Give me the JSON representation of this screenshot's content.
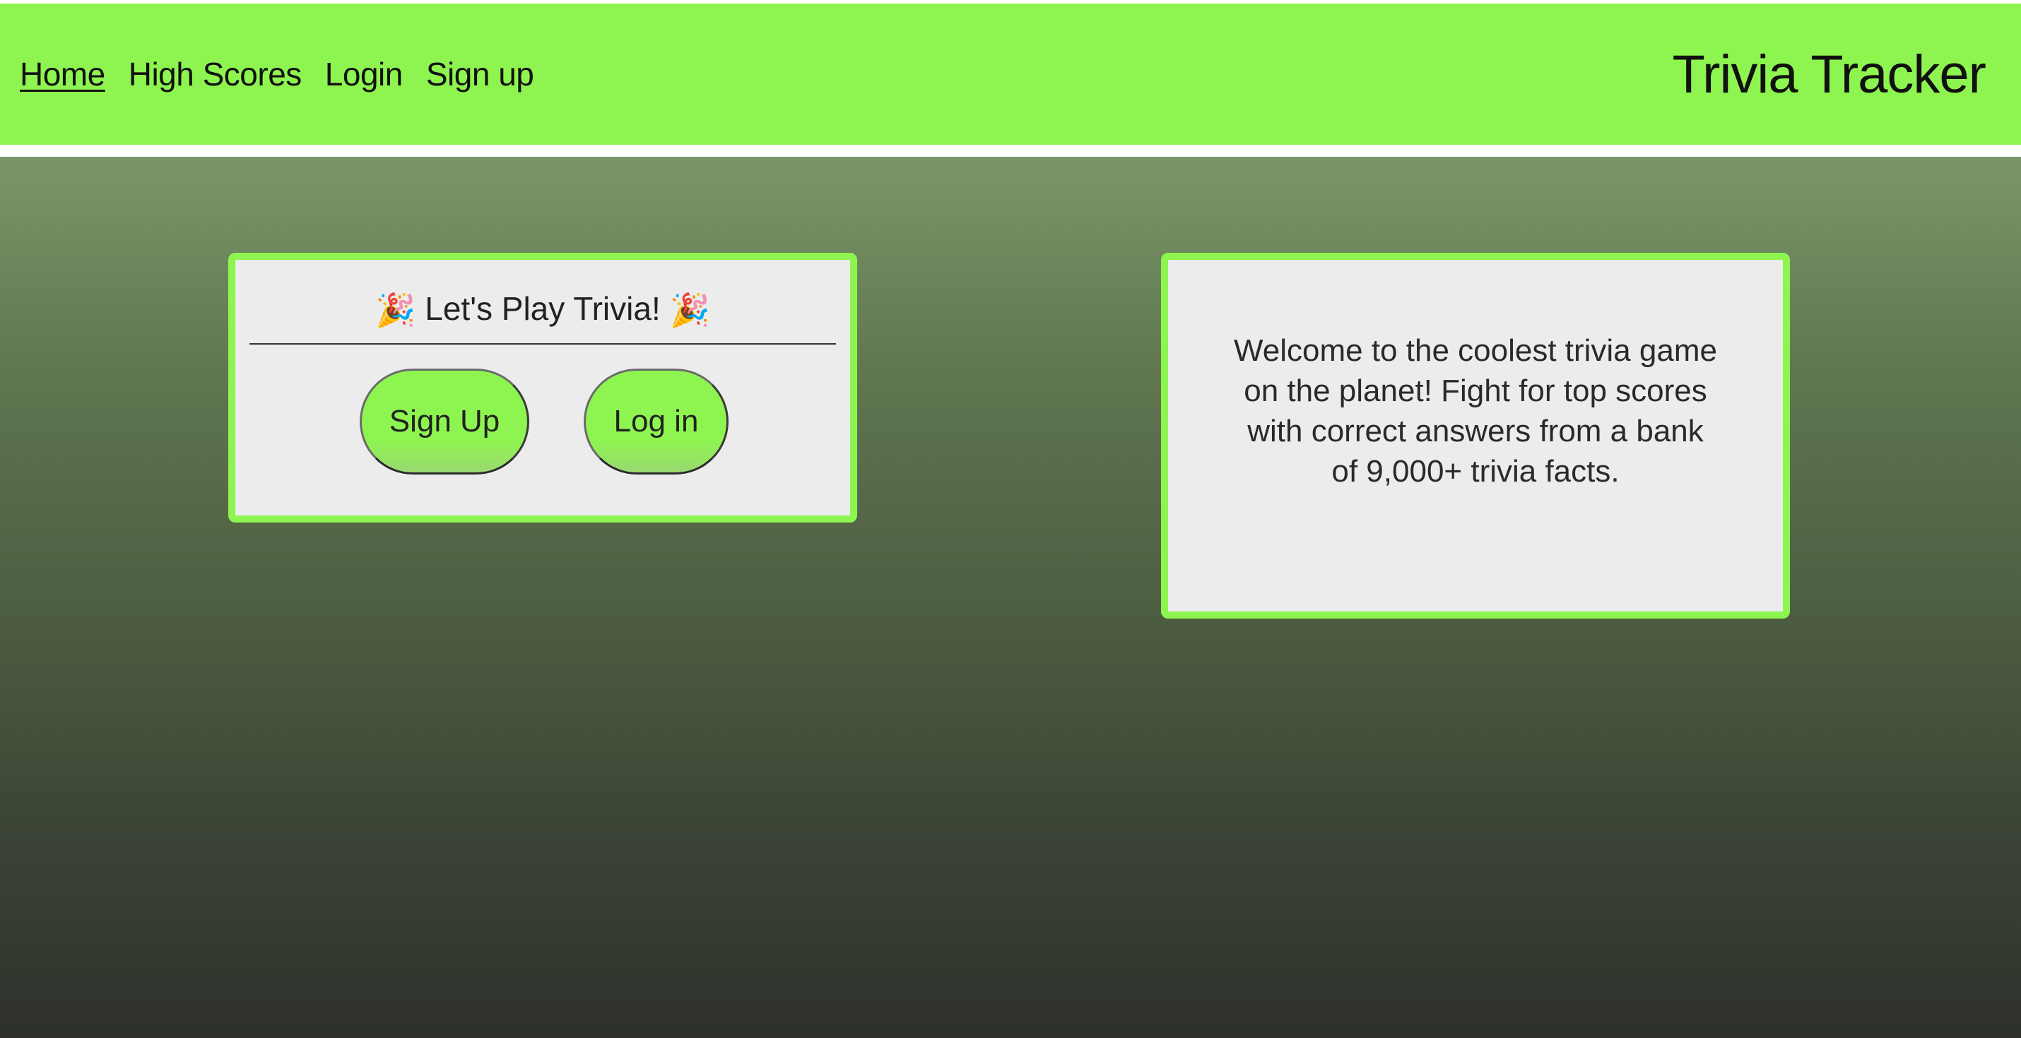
{
  "nav": {
    "items": [
      {
        "label": "Home",
        "active": true
      },
      {
        "label": "High Scores",
        "active": false
      },
      {
        "label": "Login",
        "active": false
      },
      {
        "label": "Sign up",
        "active": false
      }
    ],
    "brand": "Trivia Tracker"
  },
  "play_card": {
    "title": "Let's Play Trivia!",
    "title_emoji": "🎉",
    "signup_label": "Sign Up",
    "login_label": "Log in"
  },
  "welcome_card": {
    "text": "Welcome to the coolest trivia game on the planet! Fight for top scores with correct answers from a bank of 9,000+ trivia facts."
  },
  "colors": {
    "accent": "#8ef550",
    "card_background": "#ececec",
    "page_gradient_top": "#7c9568",
    "page_gradient_bottom": "#2e312b"
  }
}
